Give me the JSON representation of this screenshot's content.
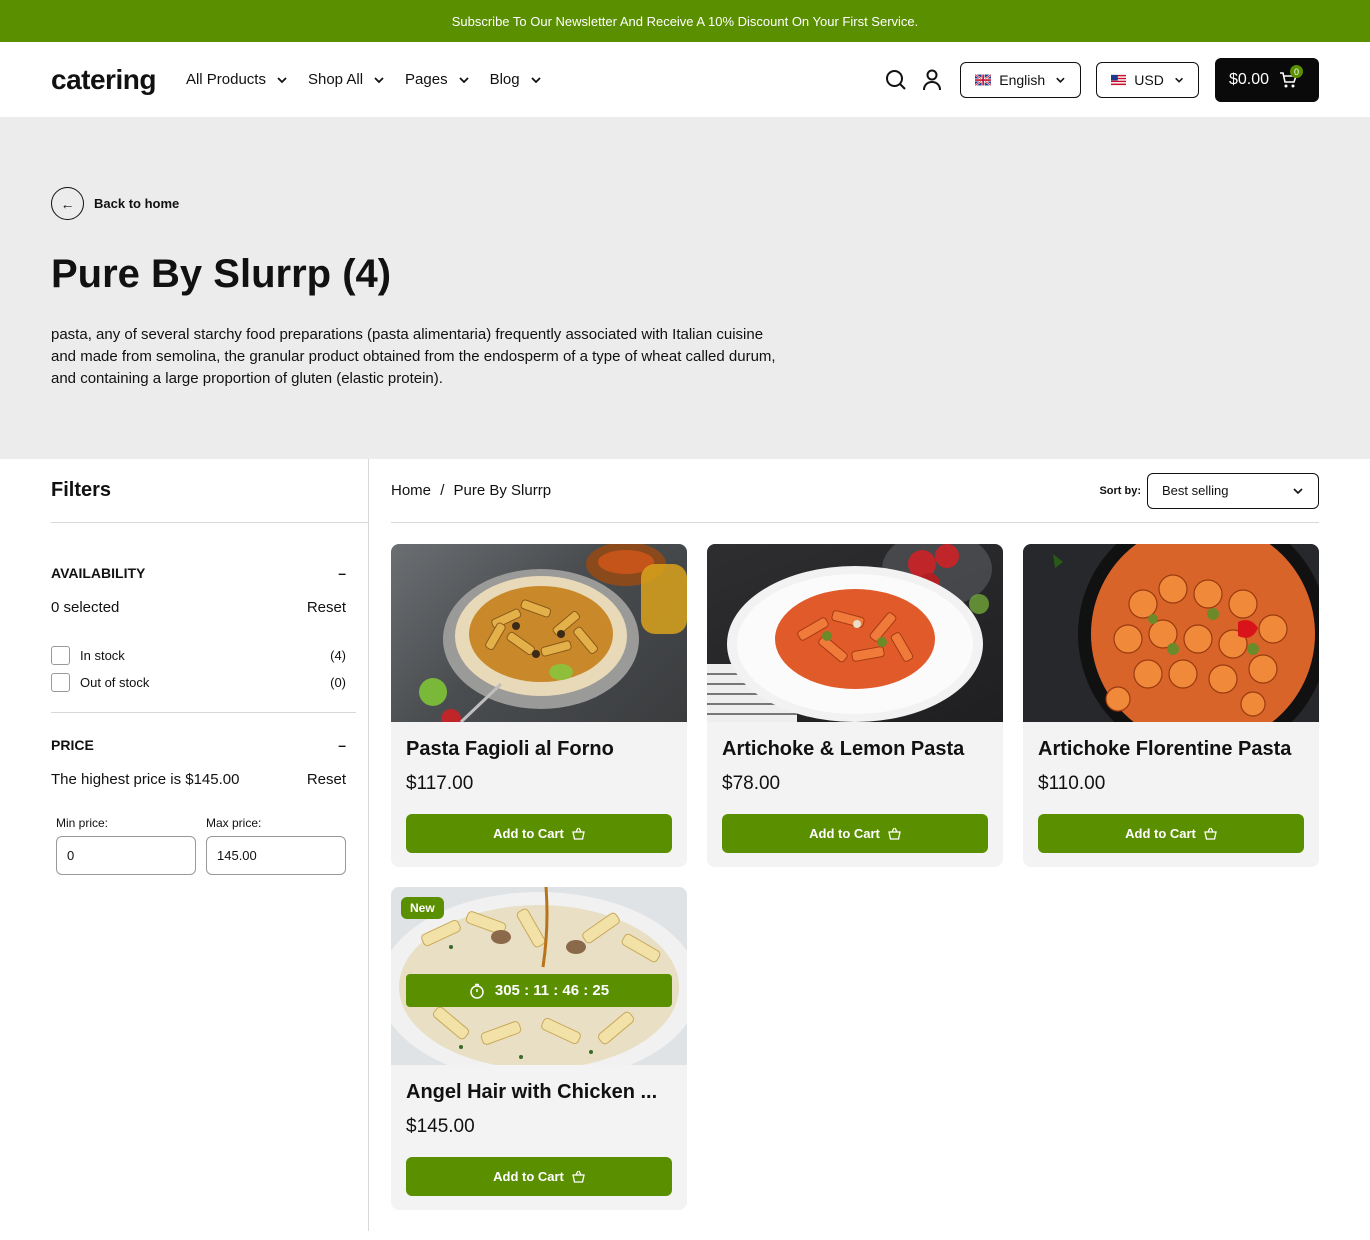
{
  "topbar": {
    "text": "Subscribe To Our Newsletter And Receive A 10% Discount On Your First Service."
  },
  "header": {
    "logo": "catering",
    "nav": [
      {
        "label": "All Products"
      },
      {
        "label": "Shop All"
      },
      {
        "label": "Pages"
      },
      {
        "label": "Blog"
      }
    ],
    "language": "English",
    "currency": "USD",
    "cart_total": "$0.00",
    "cart_count": "0"
  },
  "hero": {
    "back_label": "Back to home",
    "title": "Pure By Slurrp (4)",
    "description": "pasta, any of several starchy food preparations (pasta alimentaria) frequently associated with Italian cuisine and made from semolina, the granular product obtained from the endosperm of a type of wheat called durum, and containing a large proportion of gluten (elastic protein)."
  },
  "filters": {
    "title": "Filters",
    "availability": {
      "heading": "AVAILABILITY",
      "selected": "0 selected",
      "reset": "Reset",
      "options": [
        {
          "label": "In stock",
          "count": "(4)"
        },
        {
          "label": "Out of stock",
          "count": "(0)"
        }
      ]
    },
    "price": {
      "heading": "PRICE",
      "highest": "The highest price is $145.00",
      "reset": "Reset",
      "min_label": "Min price:",
      "max_label": "Max price:",
      "min_value": "0",
      "max_value": "145.00"
    }
  },
  "toolbar": {
    "breadcrumb_home": "Home",
    "breadcrumb_sep": "/",
    "breadcrumb_current": "Pure By Slurrp",
    "sort_label": "Sort by:",
    "sort_value": "Best selling"
  },
  "products": [
    {
      "name": "Pasta Fagioli al Forno",
      "price": "$117.00",
      "button": "Add to Cart"
    },
    {
      "name": "Artichoke & Lemon Pasta",
      "price": "$78.00",
      "button": "Add to Cart"
    },
    {
      "name": "Artichoke Florentine Pasta",
      "price": "$110.00",
      "button": "Add to Cart"
    },
    {
      "name": "Angel Hair with Chicken ...",
      "price": "$145.00",
      "button": "Add to Cart",
      "badge": "New",
      "timer": "305 : 11 : 46 : 25"
    }
  ],
  "colors": {
    "brand": "#5a9000",
    "dark": "#0a0a0a",
    "hero_bg": "#ececec"
  }
}
